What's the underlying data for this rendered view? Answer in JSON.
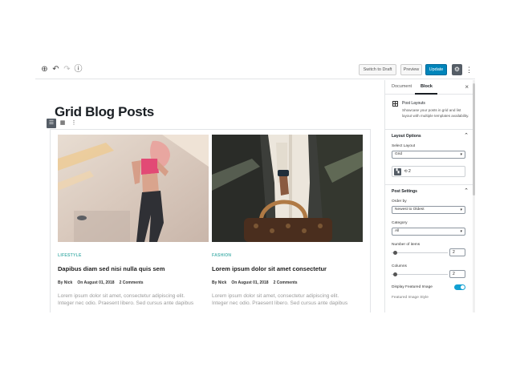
{
  "toolbar": {
    "add_icon": "plus-circle-icon",
    "undo_icon": "undo-icon",
    "redo_icon": "redo-icon",
    "info_icon": "info-icon",
    "switch_to_draft": "Switch to Draft",
    "preview": "Preview",
    "update": "Update",
    "settings_icon": "gear-icon",
    "more_icon": "vertical-ellipsis-icon"
  },
  "editor": {
    "title": "Grid Blog Posts",
    "block_toolbar": [
      "list-view-icon",
      "grid-view-icon",
      "more-options-icon"
    ],
    "posts": [
      {
        "category": "LIFESTYLE",
        "title": "Dapibus diam sed nisi nulla quis sem",
        "author": "By Nick",
        "date": "On August 01, 2018",
        "comments": "2 Comments",
        "excerpt_1": "Lorem ipsum dolor sit amet, consectetur adipiscing elit.",
        "excerpt_2": "Integer nec odio. Praesent libero. Sed cursus ante dapibus"
      },
      {
        "category": "FASHION",
        "title": "Lorem ipsum dolor sit amet consectetur",
        "author": "By Nick",
        "date": "On August 01, 2018",
        "comments": "2 Comments",
        "excerpt_1": "Lorem ipsum dolor sit amet, consectetur adipiscing elit.",
        "excerpt_2": "Integer nec odio. Praesent libero. Sed cursus ante dapibus"
      }
    ]
  },
  "sidebar": {
    "tab_document": "Document",
    "tab_block": "Block",
    "close_icon": "close-icon",
    "block_name": "Post Layouts",
    "block_description": "Showcase your posts in grid and list layout with multiple templates availability.",
    "layout_options": {
      "title": "Layout Options",
      "select_layout_label": "Select Layout",
      "select_layout_value": "Grid",
      "layout_count": "2"
    },
    "post_settings": {
      "title": "Post Settings",
      "order_by_label": "Order by",
      "order_by_value": "Newest to Oldest",
      "category_label": "Category",
      "category_value": "All",
      "number_of_items_label": "Number of items",
      "number_of_items_value": "2",
      "columns_label": "Columns",
      "columns_value": "2",
      "display_featured_image_label": "Display Featured Image",
      "display_featured_image_on": true,
      "featured_image_style_label": "Featured Image Style"
    }
  },
  "colors": {
    "accent": "#0085ba",
    "category": "#52b5b0",
    "toggle": "#11a0d2"
  }
}
